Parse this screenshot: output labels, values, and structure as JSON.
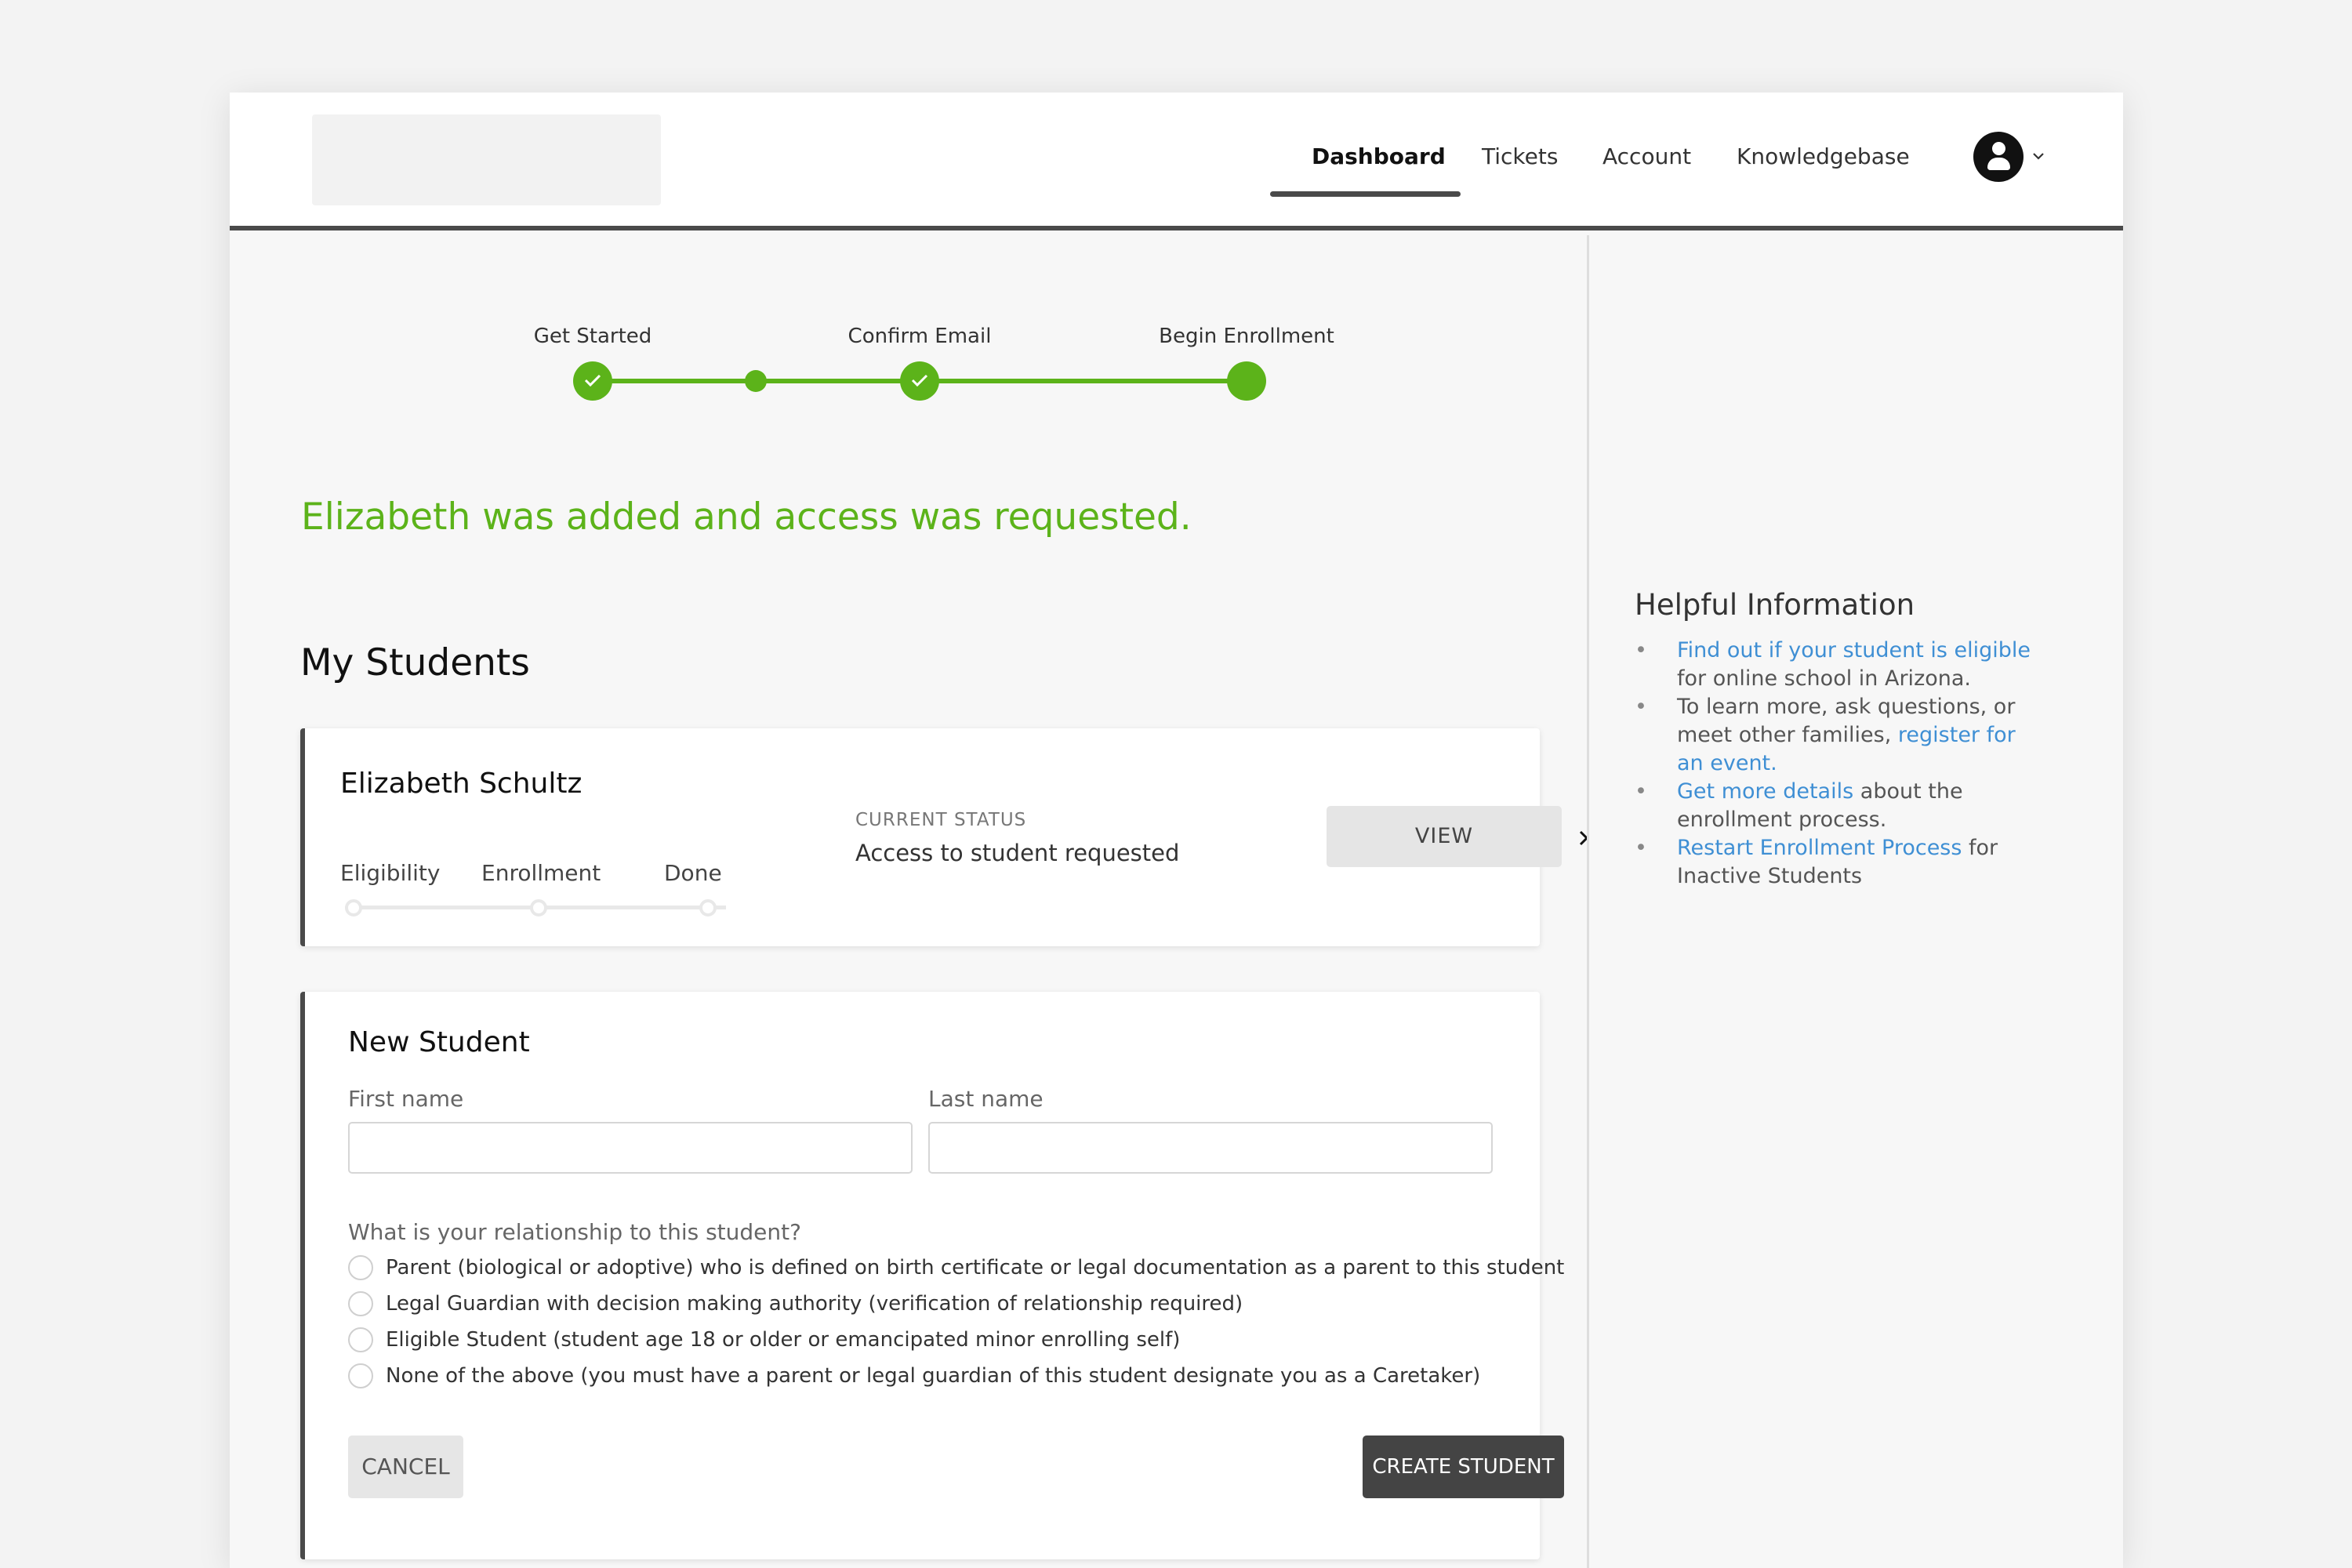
{
  "nav": {
    "items": [
      {
        "label": "Dashboard",
        "active": true
      },
      {
        "label": "Tickets",
        "active": false
      },
      {
        "label": "Account",
        "active": false
      },
      {
        "label": "Knowledgebase",
        "active": false
      }
    ],
    "avatar_icon": "user-avatar-icon",
    "menu_icon": "chevron-down-icon"
  },
  "stepper": {
    "steps": [
      {
        "label": "Get Started",
        "state": "complete"
      },
      {
        "label": "Confirm Email",
        "state": "complete"
      },
      {
        "label": "Begin Enrollment",
        "state": "current"
      }
    ],
    "color": "#5cb31a"
  },
  "success_message": "Elizabeth was added and access was requested.",
  "my_students": {
    "title": "My Students",
    "students": [
      {
        "name": "Elizabeth Schultz",
        "progress_steps": [
          "Eligibility",
          "Enrollment",
          "Done"
        ],
        "status_label": "CURRENT STATUS",
        "status_value": "Access to student requested",
        "view_label": "VIEW"
      }
    ]
  },
  "new_student": {
    "title": "New Student",
    "first_name_label": "First name",
    "first_name_value": "",
    "last_name_label": "Last name",
    "last_name_value": "",
    "relationship_question": "What is your relationship to this student?",
    "relationship_options": [
      "Parent (biological or adoptive) who is defined on birth certificate or legal documentation as a parent to this student",
      "Legal Guardian with decision making authority (verification of relationship required)",
      "Eligible Student (student age 18 or older or emancipated minor enrolling self)",
      "None of the above (you must have a parent or legal guardian of this student designate you as a Caretaker)"
    ],
    "cancel_label": "CANCEL",
    "create_label": "CREATE STUDENT"
  },
  "helpful_info": {
    "title": "Helpful Information",
    "items": [
      {
        "link": "Find out if your student is eligible",
        "text": " for online school in Arizona."
      },
      {
        "pre": "To learn more, ask questions, or meet other families, ",
        "link": "register for an event."
      },
      {
        "link": "Get more details",
        "text": " about the enrollment process."
      },
      {
        "link": "Restart Enrollment Process",
        "text": " for Inactive Students"
      }
    ]
  },
  "colors": {
    "accent_green": "#5cb31a",
    "link_blue": "#3f8fd4",
    "dark": "#4a4a4a"
  }
}
